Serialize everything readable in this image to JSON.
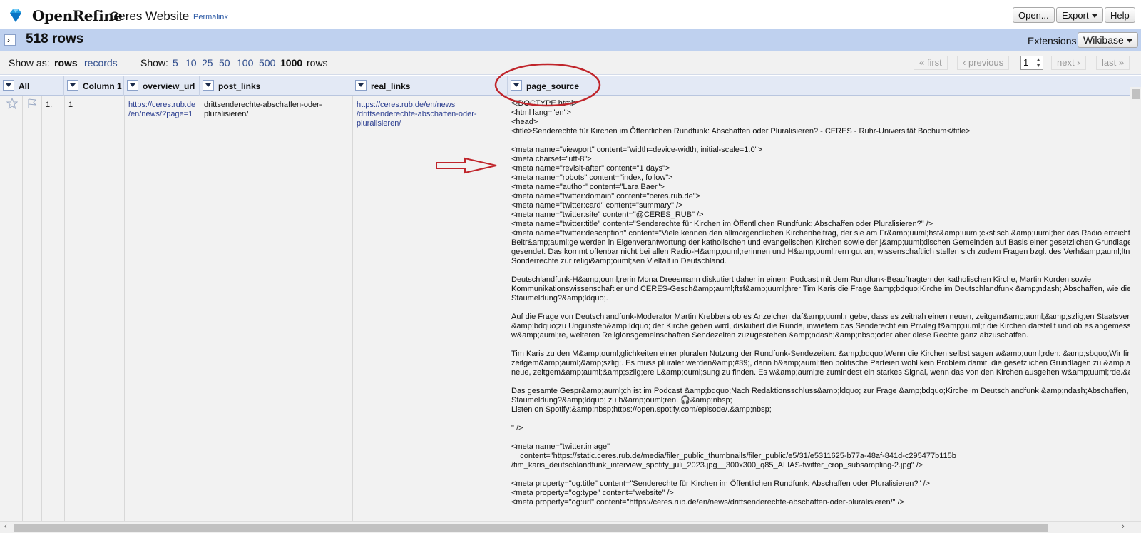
{
  "header": {
    "brand": "OpenRefine",
    "project": "Ceres Website",
    "permalink": "Permalink",
    "open_label": "Open...",
    "export_label": "Export",
    "help_label": "Help"
  },
  "bar": {
    "rows_count": "518 rows",
    "extensions_label": "Extensions",
    "wikibase_label": "Wikibase"
  },
  "controls": {
    "show_as_label": "Show as:",
    "rows_mode": "rows",
    "records_mode": "records",
    "show_label": "Show:",
    "page_sizes": [
      "5",
      "10",
      "25",
      "50",
      "100",
      "500"
    ],
    "current_size": "1000",
    "rows_suffix": "rows",
    "first": "« first",
    "previous": "‹ previous",
    "page_value": "1",
    "next": "next ›",
    "last": "last »"
  },
  "columns": [
    "All",
    "Column 1",
    "overview_url",
    "post_links",
    "real_links",
    "page_source"
  ],
  "row": {
    "index": "1.",
    "column1": "1",
    "overview_url": "https://ceres.rub.de\n/en/news/?page=1",
    "post_links": "drittsenderechte-abschaffen-oder-\npluralisieren/",
    "real_links": "https://ceres.rub.de/en/news\n/drittsenderechte-abschaffen-oder-\npluralisieren/",
    "page_source": "<!DOCTYPE html>\n<html lang=\"en\">\n<head>\n<title>Senderechte für Kirchen im Öffentlichen Rundfunk: Abschaffen oder Pluralisieren? - CERES - Ruhr-Universität Bochum</title>\n\n<meta name=\"viewport\" content=\"width=device-width, initial-scale=1.0\">\n<meta charset=\"utf-8\">\n<meta name=\"revisit-after\" content=\"1 days\">\n<meta name=\"robots\" content=\"index, follow\">\n<meta name=\"author\" content=\"Lara Baer\">\n<meta name=\"twitter:domain\" content=\"ceres.rub.de\">\n<meta name=\"twitter:card\" content=\"summary\" />\n<meta name=\"twitter:site\" content=\"@CERES_RUB\" />\n<meta name=\"twitter:title\" content=\"Senderechte für Kirchen im Öffentlichen Rundfunk: Abschaffen oder Pluralisieren?\" />\n<meta name=\"twitter:description\" content=\"Viele kennen den allmorgendlichen Kirchenbeitrag, der sie am Fr&amp;uuml;hst&amp;uuml;ckstisch &amp;uuml;ber das Radio erreicht. Die\nBeitr&amp;auml;ge werden in Eigenverantwortung der katholischen und evangelischen Kirchen sowie der j&amp;uuml;dischen Gemeinden auf Basis einer gesetzlichen Grundlage t\ngesendet. Das kommt offenbar nicht bei allen Radio-H&amp;ouml;rerinnen und H&amp;ouml;rern gut an; wissenschaftlich stellen sich zudem Fragen bzgl. des Verh&amp;auml;ltnisse\nSonderrechte zur religi&amp;ouml;sen Vielfalt in Deutschland.\n\nDeutschlandfunk-H&amp;ouml;rerin Mona Dreesmann diskutiert daher in einem Podcast mit dem Rundfunk-Beauftragten der katholischen Kirche, Martin Korden sowie\nKommunikationswissenschaftler und CERES-Gesch&amp;auml;ftsf&amp;uuml;hrer Tim Karis die Frage &amp;bdquo;Kirche im Deutschlandfunk &amp;ndash; Abschaffen, wie die\nStaumeldung?&amp;ldquo;.\n\nAuf die Frage von Deutschlandfunk-Moderator Martin Krebbers ob es Anzeichen daf&amp;uuml;r gebe, dass es zeitnah einen neuen, zeitgem&amp;auml;&amp;szlig;en Staatsvertra\n&amp;bdquo;zu Ungunsten&amp;ldquo; der Kirche geben wird, diskutiert die Runde, inwiefern das Senderecht ein Privileg f&amp;uuml;r die Kirchen darstellt und ob es angemessen\nw&amp;auml;re, weiteren Religionsgemeinschaften Sendezeiten zuzugestehen &amp;ndash;&amp;nbsp;oder aber diese Rechte ganz abzuschaffen.\n\nTim Karis zu den M&amp;ouml;glichkeiten einer pluralen Nutzung der Rundfunk-Sendezeiten: &amp;bdquo;Wenn die Kirchen selbst sagen w&amp;uuml;rden: &amp;sbquo;Wir finden\nzeitgem&amp;auml;&amp;szlig;. Es muss pluraler werden&amp;#39;, dann h&amp;auml;tten politische Parteien wohl kein Problem damit, die gesetzlichen Grundlagen zu &amp;auml;n\nneue, zeitgem&amp;auml;&amp;szlig;ere L&amp;ouml;sung zu finden. Es w&amp;auml;re zumindest ein starkes Signal, wenn das von den Kirchen ausgehen w&amp;uuml;rde.&amp;\n\nDas gesamte Gespr&amp;auml;ch ist im Podcast &amp;bdquo;Nach Redaktionsschluss&amp;ldquo; zur Frage &amp;bdquo;Kirche im Deutschlandfunk &amp;ndash;Abschaffen, wie\nStaumeldung?&amp;ldquo; zu h&amp;ouml;ren. 🎧&amp;nbsp;\nListen on Spotify:&amp;nbsp;https://open.spotify.com/episode/.&amp;nbsp;\n\n\" />\n\n<meta name=\"twitter:image\"\n    content=\"https://static.ceres.rub.de/media/filer_public_thumbnails/filer_public/e5/31/e5311625-b77a-48af-841d-c295477b115b\n/tim_karis_deutschlandfunk_interview_spotify_juli_2023.jpg__300x300_q85_ALIAS-twitter_crop_subsampling-2.jpg\" />\n\n<meta property=\"og:title\" content=\"Senderechte für Kirchen im Öffentlichen Rundfunk: Abschaffen oder Pluralisieren?\" />\n<meta property=\"og:type\" content=\"website\" />\n<meta property=\"og:url\" content=\"https://ceres.rub.de/en/news/drittsenderechte-abschaffen-oder-pluralisieren/\" />"
  },
  "colors": {
    "accent_bar": "#bfd1ef",
    "header_row": "#e3e9f5",
    "link": "#2e4c8c",
    "annotation": "#c0252b"
  },
  "icons": [
    "openrefine-diamond-icon",
    "star-icon",
    "flag-icon",
    "dropdown-icon",
    "arrow-right-icon"
  ]
}
